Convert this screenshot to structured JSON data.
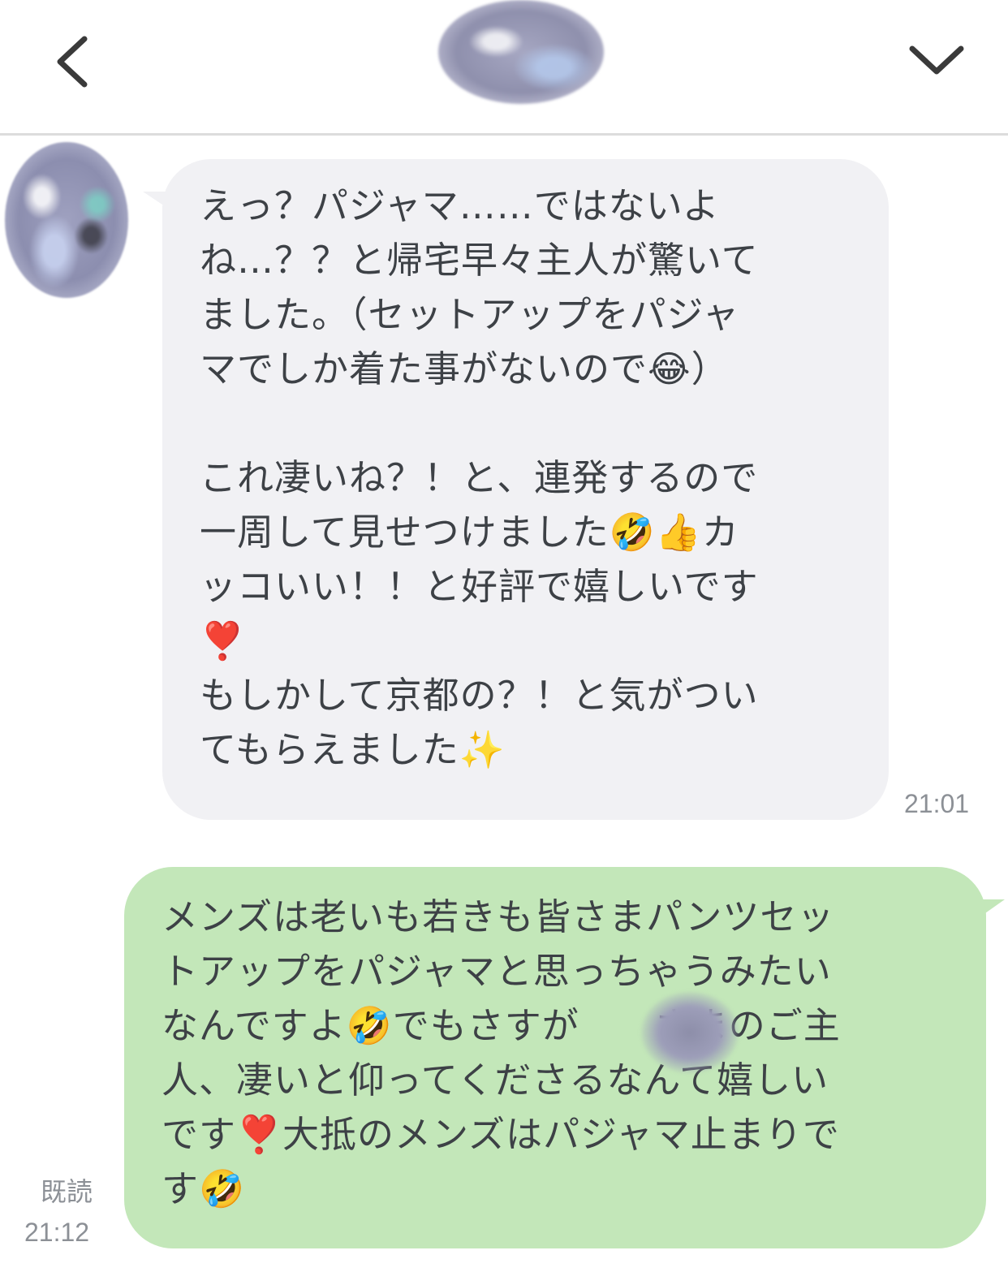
{
  "header": {
    "back_icon": "chevron-left-icon",
    "menu_icon": "chevron-down-icon"
  },
  "messages": [
    {
      "side": "incoming",
      "text": "えっ？パジャマ……ではないよ\nね…？？と帰宅早々主人が驚いて\nました。（セットアップをパジャ\nマでしか着た事がないので😂）\n\nこれ凄いね？！と、連発するので\n一周して見せつけました🤣👍カ\nッコいい！！と好評で嬉しいです\n❣️\nもしかして京都の？！と気がつい\nてもらえました✨",
      "time": "21:01"
    },
    {
      "side": "outgoing",
      "text": "メンズは老いも若きも皆さまパンツセッ\nトアップをパジャマと思っちゃうみたい\nなんですよ🤣でもさすが　　さまのご主\n人、凄いと仰ってくださるなんて嬉しい\nです❣️大抵のメンズはパジャマ止まりで\nす🤣",
      "read": "既読",
      "time": "21:12"
    }
  ],
  "colors": {
    "incoming_bubble": "#f1f1f4",
    "outgoing_bubble": "#c3e7b9",
    "timestamp": "#8c9096"
  }
}
